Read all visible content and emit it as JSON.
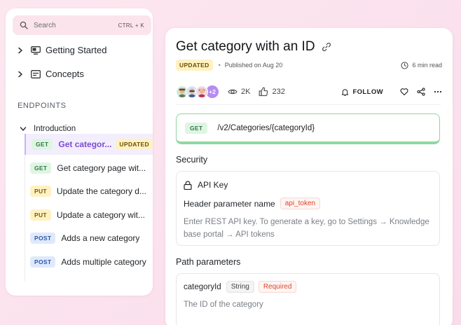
{
  "search": {
    "placeholder": "Search",
    "shortcut": "CTRL + K"
  },
  "sidebar": {
    "top_items": [
      {
        "label": "Getting Started",
        "icon": "monitor-icon"
      },
      {
        "label": "Concepts",
        "icon": "card-icon"
      }
    ],
    "section_title": "ENDPOINTS",
    "group_label": "Introduction",
    "endpoints": [
      {
        "method": "GET",
        "label": "Get categor...",
        "badge": "UPDATED",
        "active": true
      },
      {
        "method": "GET",
        "label": "Get category page wit..."
      },
      {
        "method": "PUT",
        "label": "Update the category d..."
      },
      {
        "method": "PUT",
        "label": "Update a category wit..."
      },
      {
        "method": "POST",
        "label": "Adds a new category"
      },
      {
        "method": "POST",
        "label": "Adds multiple category"
      }
    ]
  },
  "article": {
    "title": "Get category with an ID",
    "badge": "UPDATED",
    "published": "Published on Aug 20",
    "read_time": "6 min read",
    "avatars_more": "+2",
    "views": "2K",
    "likes": "232",
    "follow_label": "FOLLOW",
    "endpoint": {
      "method": "GET",
      "path": "/v2/Categories/{categoryId}"
    },
    "security": {
      "heading": "Security",
      "auth_title": "API Key",
      "header_param_label": "Header parameter name",
      "header_param_value": "api_token",
      "description": "Enter REST API key. To generate a key, go to Settings → Knowledge base portal → API tokens"
    },
    "path_params": {
      "heading": "Path parameters",
      "name": "categoryId",
      "type": "String",
      "required": "Required",
      "description": "The ID of the category"
    }
  },
  "colors": {
    "accent_purple": "#7c4bd4",
    "get_green": "#2f7a42",
    "put_yellow": "#7a5a00",
    "post_blue": "#2b58a8",
    "required_red": "#d9472b",
    "endpoint_border": "#8ed9a1"
  }
}
